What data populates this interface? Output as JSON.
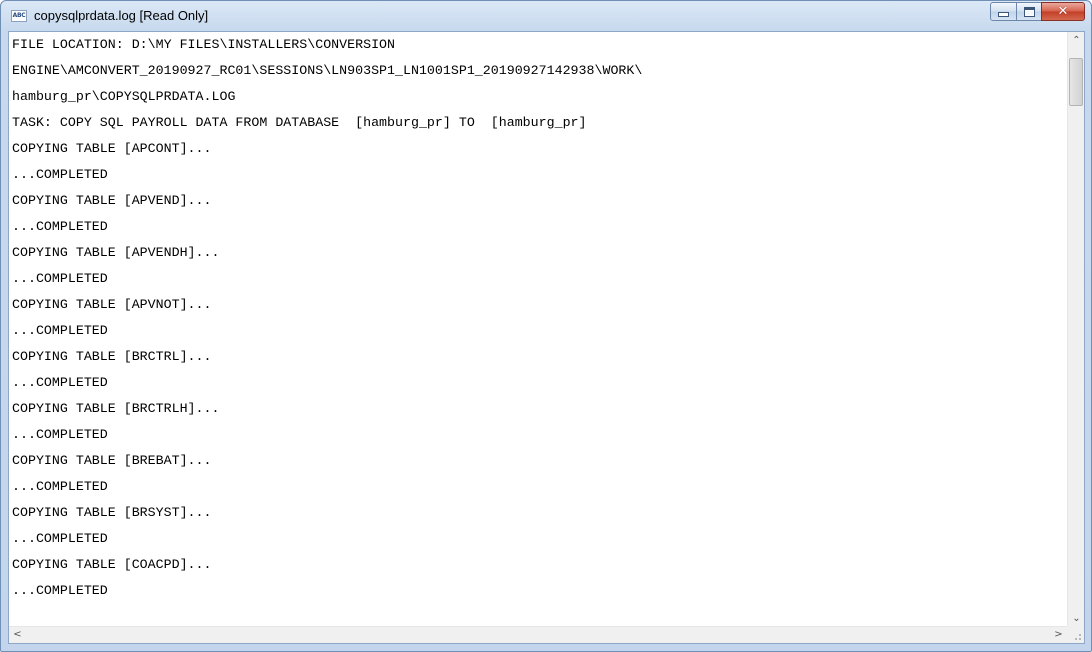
{
  "window": {
    "title": "copysqlprdata.log [Read Only]",
    "icon_text": "ABC",
    "icon": "text-document-icon"
  },
  "caption_buttons": {
    "minimize_icon": "minimize-icon",
    "maximize_icon": "maximize-icon",
    "close_glyph": "✕"
  },
  "log": {
    "lines": [
      "FILE LOCATION: D:\\MY FILES\\INSTALLERS\\CONVERSION",
      "ENGINE\\AMCONVERT_20190927_RC01\\SESSIONS\\LN903SP1_LN1001SP1_20190927142938\\WORK\\",
      "hamburg_pr\\COPYSQLPRDATA.LOG",
      "TASK: COPY SQL PAYROLL DATA FROM DATABASE  [hamburg_pr] TO  [hamburg_pr]",
      "COPYING TABLE [APCONT]...",
      "...COMPLETED",
      "COPYING TABLE [APVEND]...",
      "...COMPLETED",
      "COPYING TABLE [APVENDH]...",
      "...COMPLETED",
      "COPYING TABLE [APVNOT]...",
      "...COMPLETED",
      "COPYING TABLE [BRCTRL]...",
      "...COMPLETED",
      "COPYING TABLE [BRCTRLH]...",
      "...COMPLETED",
      "COPYING TABLE [BREBAT]...",
      "...COMPLETED",
      "COPYING TABLE [BRSYST]...",
      "...COMPLETED",
      "COPYING TABLE [COACPD]...",
      "...COMPLETED"
    ]
  },
  "scrollbars": {
    "up_glyph": "⌃",
    "down_glyph": "⌄",
    "left_glyph": "<",
    "right_glyph": ">"
  },
  "colors": {
    "title_bar": "#c7d9ee",
    "close_button": "#c23e26",
    "text": "#000000",
    "background": "#ffffff"
  }
}
